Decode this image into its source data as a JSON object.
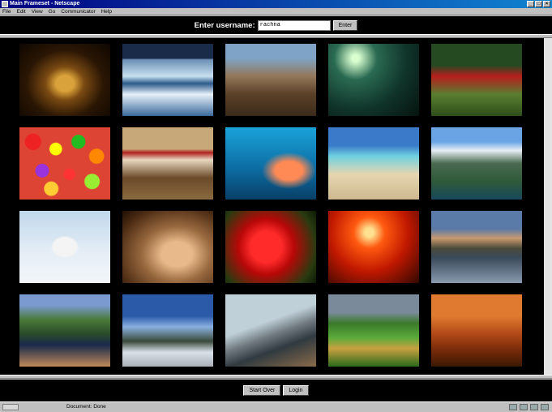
{
  "window": {
    "title": "Main Frameset - Netscape"
  },
  "menu": [
    "File",
    "Edit",
    "View",
    "Go",
    "Communicator",
    "Help"
  ],
  "login_bar": {
    "label": "Enter username:",
    "username_value": "rachna",
    "enter_label": "Enter"
  },
  "gallery": [
    {
      "name": "buddha-statue",
      "cls": "t-buddha"
    },
    {
      "name": "penguins-iceberg",
      "cls": "t-penguins"
    },
    {
      "name": "safari-cattle",
      "cls": "t-safari"
    },
    {
      "name": "moonlit-shore",
      "cls": "t-night"
    },
    {
      "name": "binocular-watcher",
      "cls": "t-binoc"
    },
    {
      "name": "jelly-beans",
      "cls": "t-jelly"
    },
    {
      "name": "rodeo-rider",
      "cls": "t-rodeo"
    },
    {
      "name": "scuba-diver",
      "cls": "t-diver"
    },
    {
      "name": "tropical-beach",
      "cls": "t-beach"
    },
    {
      "name": "mountain-lake",
      "cls": "t-mount"
    },
    {
      "name": "polar-bears",
      "cls": "t-polar"
    },
    {
      "name": "cave-formation",
      "cls": "t-cave"
    },
    {
      "name": "red-rose",
      "cls": "t-rose"
    },
    {
      "name": "sunset-trees",
      "cls": "t-sunset"
    },
    {
      "name": "lakeside-town",
      "cls": "t-lake"
    },
    {
      "name": "coastal-cliffs",
      "cls": "t-coast"
    },
    {
      "name": "mountain-hiker",
      "cls": "t-hiker"
    },
    {
      "name": "bridge-cable",
      "cls": "t-bridge"
    },
    {
      "name": "formal-garden",
      "cls": "t-garden"
    },
    {
      "name": "woodworking-shop",
      "cls": "t-workshop"
    }
  ],
  "bottom_bar": {
    "start_over_label": "Start Over",
    "login_label": "Login"
  },
  "status": {
    "text": "Document: Done"
  }
}
